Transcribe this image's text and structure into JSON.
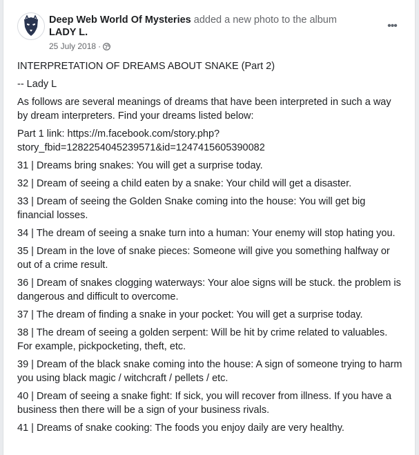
{
  "post": {
    "page_name": "Deep Web World Of Mysteries",
    "action_text": " added a new photo to the album ",
    "album_name": "LADY L.",
    "date": "25 July 2018",
    "date_separator": "·",
    "privacy_icon": "globe-icon",
    "more_label": "•••"
  },
  "content": {
    "title": "INTERPRETATION OF DREAMS ABOUT SNAKE (Part 2)",
    "author": "-- Lady L",
    "intro": "As follows are several meanings of dreams that have been interpreted in such a way by dream interpreters. Find your dreams listed below:",
    "link_label": "Part 1 link: ",
    "link_url": "https://m.facebook.com/story.php?story_fbid=1282254045239571&id=1247415605390082",
    "items": [
      "31 | Dreams bring snakes: You will get a surprise today.",
      "32 | Dream of seeing a child eaten by a snake: Your child will get a disaster.",
      "33 | Dream of seeing the Golden Snake coming into the house: You will get big financial losses.",
      "34 | The dream of seeing a snake turn into a human: Your enemy will stop hating you.",
      "35 | Dream in the love of snake pieces: Someone will give you something halfway or out of a crime result.",
      "36 | Dream of snakes clogging waterways: Your aloe signs will be stuck. the problem is dangerous and difficult to overcome.",
      "37 | The dream of finding a snake in your pocket: You will get a surprise today.",
      "38 | The dream of seeing a golden serpent: Will be hit by crime related to valuables. For example, pickpocketing, theft, etc.",
      "39 | Dream of the black snake coming into the house: A sign of someone trying to harm you using black magic / witchcraft / pellets / etc.",
      "40 | Dream of seeing a snake fight: If sick, you will recover from illness. If you have a business then there will be a sign of your business rivals.",
      "41 | Dreams of snake cooking: The foods you enjoy daily are very healthy."
    ]
  },
  "colors": {
    "background": "#e9ebee",
    "card": "#ffffff",
    "text": "#1c1e21",
    "secondary": "#65676b",
    "avatar_dark": "#2a3550"
  }
}
